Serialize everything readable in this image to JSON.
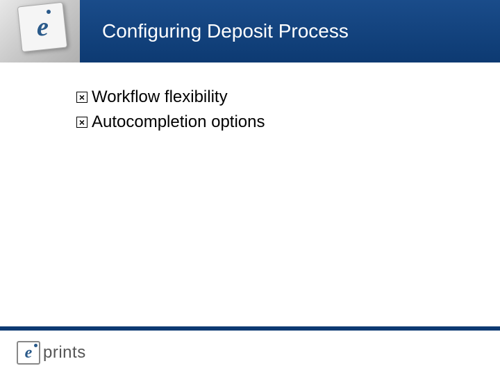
{
  "header": {
    "title": "Configuring Deposit Process"
  },
  "bullets": {
    "items": [
      {
        "text": "Workflow flexibility"
      },
      {
        "text": "Autocompletion options"
      }
    ]
  },
  "footer": {
    "logo_text": "prints"
  }
}
